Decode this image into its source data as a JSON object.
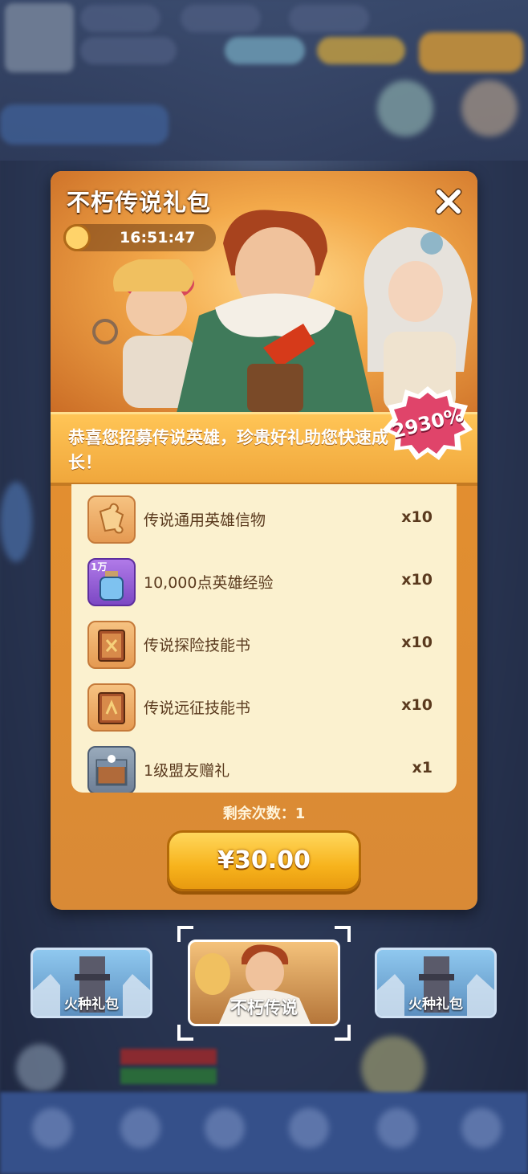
{
  "pack": {
    "title": "不朽传说礼包",
    "timer": "16:51:47",
    "description": "恭喜您招募传说英雄，珍贵好礼助您快速成长！",
    "discount_badge": "2930%",
    "remaining_label": "剩余次数：1",
    "price_label": "¥30.00"
  },
  "items": [
    {
      "name": "传说通用英雄信物",
      "qty": "x10",
      "icon": "puzzle-piece-icon"
    },
    {
      "name": "10,000点英雄经验",
      "qty": "x10",
      "icon": "potion-bottle-icon",
      "icon_tag": "1万"
    },
    {
      "name": "传说探险技能书",
      "qty": "x10",
      "icon": "skill-book-icon"
    },
    {
      "name": "传说远征技能书",
      "qty": "x10",
      "icon": "skill-book-icon"
    },
    {
      "name": "1级盟友赠礼",
      "qty": "x1",
      "icon": "gift-chest-icon"
    }
  ],
  "tabs": [
    {
      "label": "火种礼包",
      "active": false
    },
    {
      "label": "不朽传说",
      "active": true
    },
    {
      "label": "火种礼包",
      "active": false
    }
  ],
  "colors": {
    "panel": "#e48f2e",
    "ribbon": "#f0a73c",
    "list_bg": "#fbf1cf",
    "button": "#f7b31c",
    "badge": "#e0446a"
  }
}
